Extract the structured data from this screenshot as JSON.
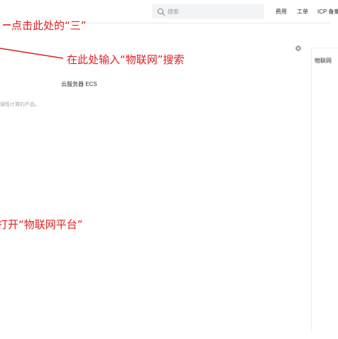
{
  "header": {
    "search": {
      "placeholder": "搜索",
      "value": ""
    },
    "nav": {
      "fees": "费用",
      "ticket": "工单",
      "icp": "ICP 备案"
    }
  },
  "annotations": {
    "step1": "点击此处的“三”",
    "step2": "在此处输入“物联网”搜索",
    "step3": "打开“物联网平台”"
  },
  "side_panel": {
    "label": "物联网"
  },
  "results": {
    "title": "云服务器 ECS",
    "desc": "弹性计算的产品。"
  },
  "colors": {
    "annotation": "#e02020",
    "search_bg": "#f3f4f6"
  }
}
